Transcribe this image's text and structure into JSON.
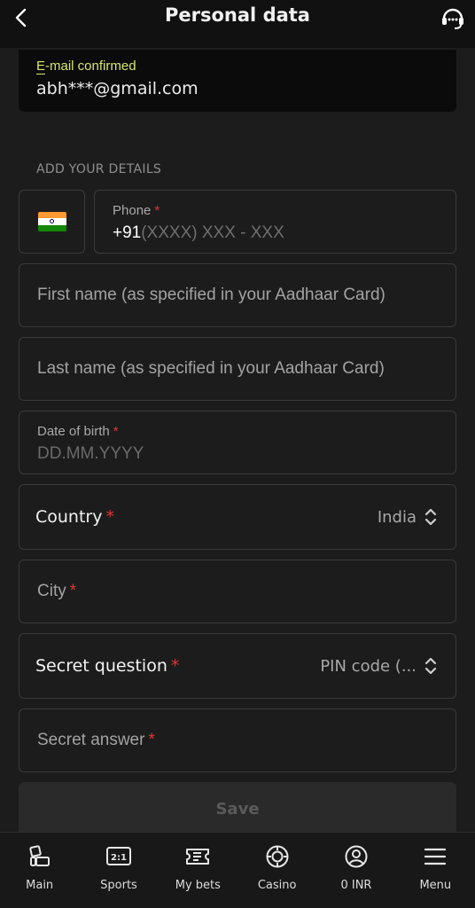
{
  "header": {
    "title": "Personal data"
  },
  "email": {
    "label_first_letter": "E",
    "label_rest": "-mail confirmed",
    "value": "abh***@gmail.com"
  },
  "section": {
    "heading": "ADD YOUR DETAILS"
  },
  "phone": {
    "label": "Phone",
    "required_mark": "*",
    "prefix": "+91",
    "mask": "(XXXX) XXX - XXX"
  },
  "first_name": {
    "placeholder": "First name (as specified in your Aadhaar Card)"
  },
  "last_name": {
    "placeholder": "Last name (as specified in your Aadhaar Card)"
  },
  "dob": {
    "label": "Date of birth",
    "required_mark": "*",
    "mask": "DD.MM.YYYY"
  },
  "country": {
    "label": "Country",
    "required_mark": "*",
    "value": "India"
  },
  "city": {
    "placeholder": "City",
    "required_mark": "*"
  },
  "secret_question": {
    "label": "Secret question",
    "required_mark": "*",
    "value": "PIN code (..."
  },
  "secret_answer": {
    "placeholder": "Secret answer",
    "required_mark": "*"
  },
  "save": {
    "label": "Save"
  },
  "nav": {
    "items": [
      {
        "label": "Main",
        "icon": "main-icon"
      },
      {
        "label": "Sports",
        "icon": "sports-icon",
        "badge": "2:1"
      },
      {
        "label": "My bets",
        "icon": "ticket-icon"
      },
      {
        "label": "Casino",
        "icon": "chip-icon"
      },
      {
        "label": "0 INR",
        "icon": "user-icon"
      },
      {
        "label": "Menu",
        "icon": "hamburger-icon"
      }
    ]
  },
  "colors": {
    "accent": "#d8e66b",
    "required": "#e03535",
    "background": "#1c1c1c"
  }
}
